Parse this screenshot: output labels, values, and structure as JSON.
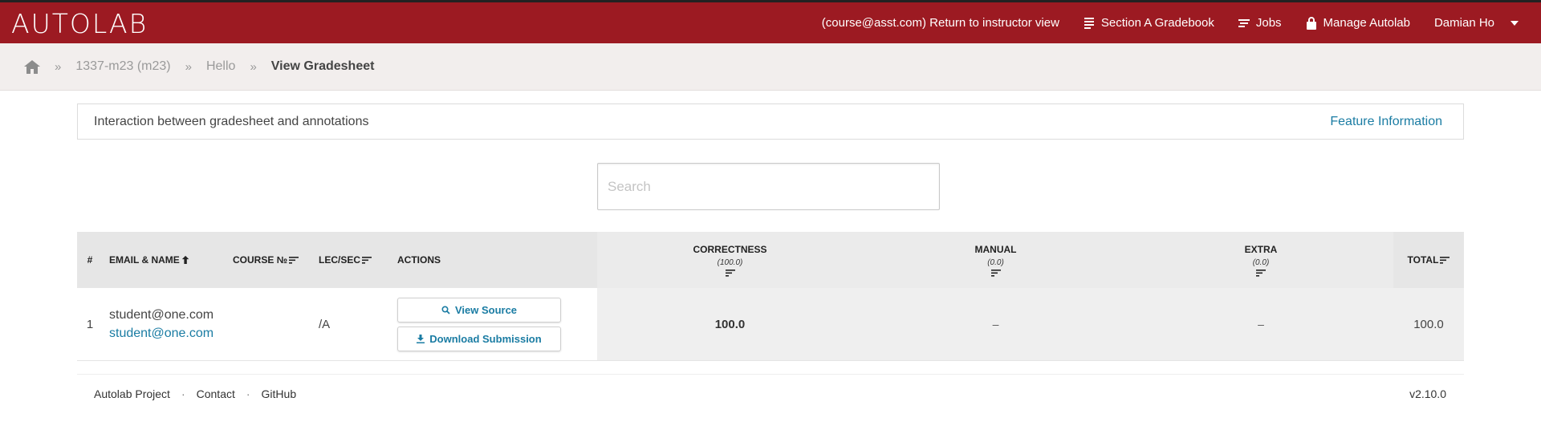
{
  "brand": {
    "logo_text": "AUTOLAB"
  },
  "nav": {
    "instructor_view": "(course@asst.com) Return to instructor view",
    "gradebook": "Section A Gradebook",
    "jobs": "Jobs",
    "manage": "Manage Autolab",
    "user": "Damian Ho"
  },
  "breadcrumb": {
    "items": [
      "1337-m23 (m23)",
      "Hello"
    ],
    "current": "View Gradesheet"
  },
  "info": {
    "text": "Interaction between gradesheet and annotations",
    "link": "Feature Information"
  },
  "search": {
    "placeholder": "Search"
  },
  "table": {
    "headers": {
      "num": "#",
      "email": "EMAIL & NAME",
      "course": "COURSE №",
      "lec": "LEC/SEC",
      "actions": "ACTIONS",
      "correctness": "CORRECTNESS",
      "correctness_max": "(100.0)",
      "manual": "MANUAL",
      "manual_max": "(0.0)",
      "extra": "EXTRA",
      "extra_max": "(0.0)",
      "total": "TOTAL"
    },
    "rows": [
      {
        "num": "1",
        "email": "student@one.com",
        "name": "student@one.com",
        "course": "",
        "lec": "/A",
        "view_source": "View Source",
        "download": "Download Submission",
        "correctness": "100.0",
        "manual": "–",
        "extra": "–",
        "total": "100.0"
      }
    ]
  },
  "footer": {
    "links": [
      "Autolab Project",
      "Contact",
      "GitHub"
    ],
    "version": "v2.10.0"
  },
  "colors": {
    "navbar": "#9c1a22",
    "link": "#1a7ca3",
    "breadcrumb_bg": "#f2eeed"
  }
}
